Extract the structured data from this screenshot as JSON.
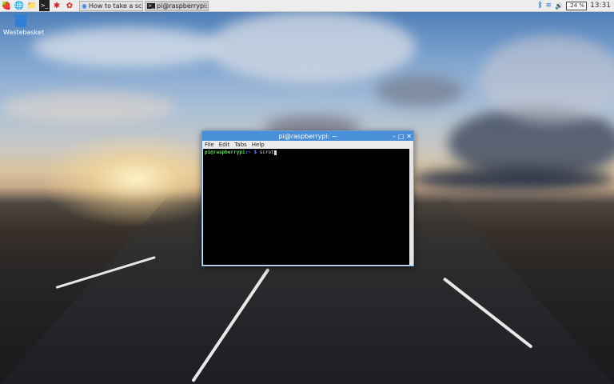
{
  "panel": {
    "launchers": [
      {
        "icon": "raspberry-menu-icon",
        "glyph": "🍓"
      },
      {
        "icon": "web-browser-icon",
        "glyph": "🌐"
      },
      {
        "icon": "file-manager-icon",
        "glyph": "📁"
      },
      {
        "icon": "terminal-icon",
        "glyph": ">_"
      },
      {
        "icon": "math-icon",
        "glyph": "✱"
      },
      {
        "icon": "wolfram-icon",
        "glyph": "✿"
      }
    ],
    "tasks": [
      {
        "label": "How to take a screen...",
        "icon": "chromium-icon",
        "glyph": "◉"
      },
      {
        "label": "pi@raspberrypi: ~",
        "icon": "terminal-task-icon",
        "glyph": ">_"
      }
    ],
    "tray": {
      "bluetooth": "ᛒ",
      "wifi": "≋",
      "volume": "🔊",
      "cpu": ".24 %",
      "clock": "13:31"
    }
  },
  "desktop": {
    "trash_label": "Wastebasket"
  },
  "terminal": {
    "title": "pi@raspberrypi: ~",
    "controls": [
      "–",
      "▢",
      "✕"
    ],
    "menu": [
      "File",
      "Edit",
      "Tabs",
      "Help"
    ],
    "prompt_user": "pi@raspberrypi",
    "prompt_path": "~",
    "prompt_symbol": "$",
    "command": "scrot"
  }
}
